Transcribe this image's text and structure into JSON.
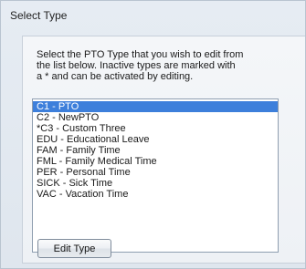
{
  "dialog": {
    "title": "Select Type",
    "instructions": "Select the PTO Type that you wish to edit from\nthe list below.  Inactive types are marked with\na * and can be activated by editing.",
    "list": {
      "items": [
        {
          "label": "C1 - PTO",
          "selected": true
        },
        {
          "label": "C2 - NewPTO",
          "selected": false
        },
        {
          "label": "*C3 - Custom Three",
          "selected": false
        },
        {
          "label": "EDU - Educational Leave",
          "selected": false
        },
        {
          "label": "FAM - Family Time",
          "selected": false
        },
        {
          "label": "FML - Family Medical Time",
          "selected": false
        },
        {
          "label": "PER - Personal Time",
          "selected": false
        },
        {
          "label": "SICK - Sick Time",
          "selected": false
        },
        {
          "label": "VAC - Vacation Time",
          "selected": false
        }
      ]
    },
    "edit_button_label": "Edit Type"
  },
  "colors": {
    "selection": "#3d7fdb",
    "background": "#e6ecf3"
  }
}
